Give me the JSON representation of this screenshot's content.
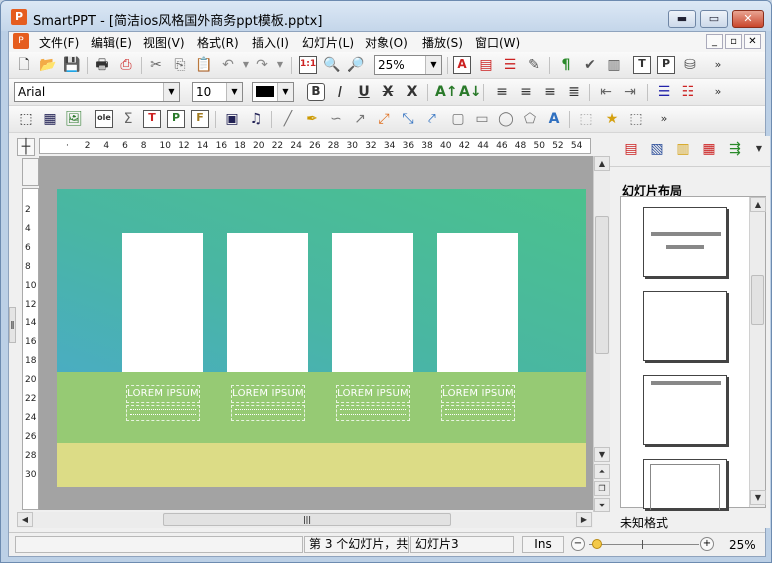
{
  "window": {
    "app_name": "SmartPPT",
    "title": "SmartPPT - [简洁ios风格国外商务ppt模板.pptx]",
    "btn_min": "▬",
    "btn_max": "▭",
    "btn_close": "✕"
  },
  "menu": [
    "文件(F)",
    "编辑(E)",
    "视图(V)",
    "格式(R)",
    "插入(I)",
    "幻灯片(L)",
    "对象(O)",
    "播放(S)",
    "窗口(W)"
  ],
  "doc_controls": [
    "_",
    "▫",
    "✕"
  ],
  "toolbar1": {
    "zoom_value": "25%",
    "icons": [
      "new-icon",
      "open-icon",
      "save-icon",
      "print-icon",
      "pdf-icon",
      "cut-icon",
      "copy-icon",
      "paste-icon",
      "undo-icon",
      "redo-icon",
      "slide-number-icon",
      "find-icon",
      "zoom-icon"
    ],
    "right_icons": [
      "text-color-icon",
      "format-icon",
      "list-icon",
      "brush-icon",
      "paragraph-icon",
      "spell-icon",
      "chart-icon",
      "table-t-icon",
      "table-p-icon",
      "database-icon"
    ]
  },
  "toolbar2": {
    "font_name": "Arial",
    "font_size": "10",
    "color": "#000000"
  },
  "ruler": {
    "h_labels": [
      "·",
      "2",
      "4",
      "6",
      "8",
      "10",
      "12",
      "14",
      "16",
      "18",
      "20",
      "22",
      "24",
      "26",
      "28",
      "30",
      "32",
      "34",
      "36",
      "38",
      "40",
      "42",
      "44",
      "46",
      "48",
      "50",
      "52",
      "54"
    ],
    "v_labels": [
      "2",
      "4",
      "6",
      "8",
      "10",
      "12",
      "14",
      "16",
      "18",
      "20",
      "22",
      "24",
      "26",
      "28",
      "30"
    ]
  },
  "slide": {
    "bg_colors": [
      "#4bc18d",
      "#4aa6d8"
    ],
    "band_color": "#96ca74",
    "footer_color": "#dcdc86",
    "cards": [
      {
        "heading": "LOREM IPSUM"
      },
      {
        "heading": "LOREM IPSUM"
      },
      {
        "heading": "LOREM IPSUM"
      },
      {
        "heading": "LOREM IPSUM"
      }
    ]
  },
  "right_panel": {
    "title": "幻灯片布局",
    "footer": "未知格式"
  },
  "status": {
    "slide_info": "第 3 个幻灯片，共",
    "slide_name": "幻灯片3",
    "mode": "Ins",
    "zoom": "25%"
  }
}
